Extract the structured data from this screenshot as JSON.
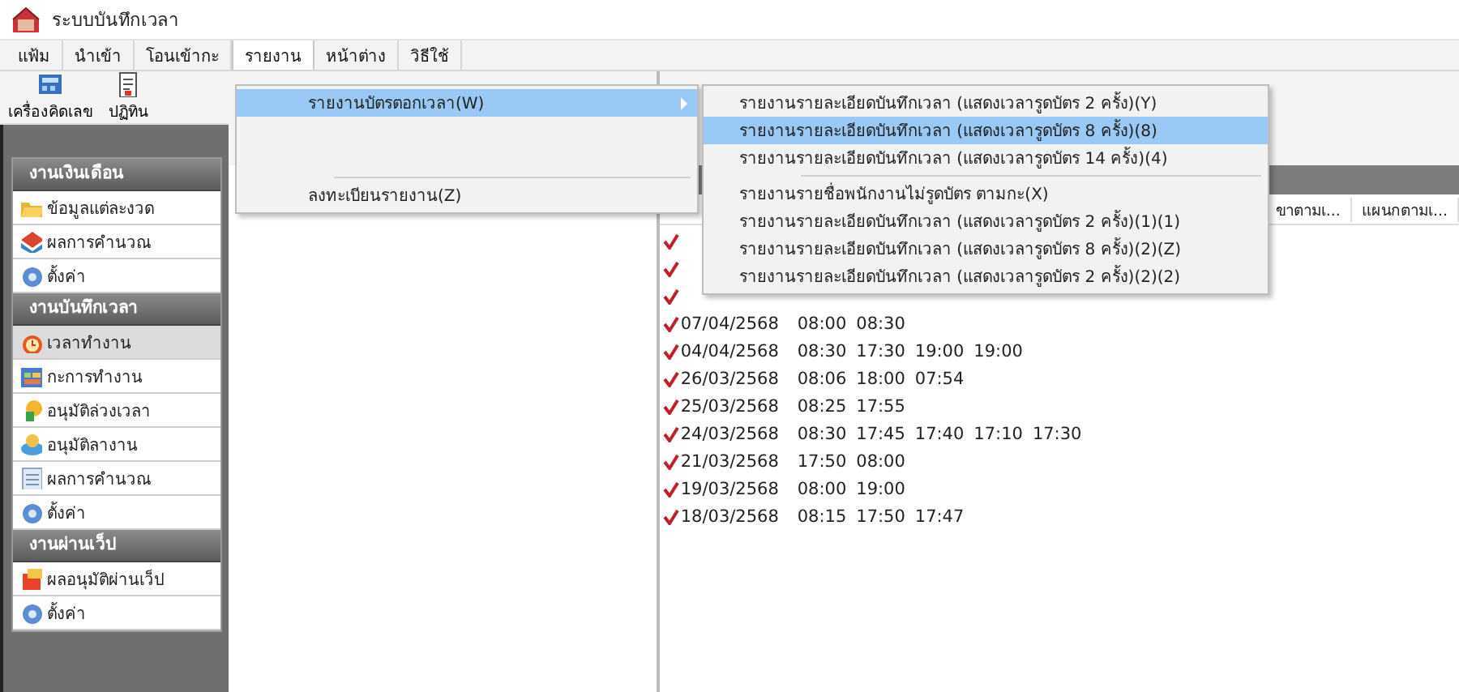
{
  "window": {
    "title": "ระบบบันทึกเวลา"
  },
  "menu_bar": [
    {
      "label": "แฟ้ม",
      "selected": false
    },
    {
      "label": "นำเข้า",
      "selected": false
    },
    {
      "label": "โอนเข้ากะ",
      "selected": false
    },
    {
      "label": "รายงาน",
      "selected": true
    },
    {
      "label": "หน้าต่าง",
      "selected": false
    },
    {
      "label": "วิธีใช้",
      "selected": false
    }
  ],
  "toolbar": [
    {
      "label": "เครื่องคิดเลข",
      "kind": "calculator"
    },
    {
      "label": "ปฏิทิน",
      "kind": "calendar"
    }
  ],
  "sidebar": {
    "groups": [
      {
        "title": "งานเงินเดือน",
        "items": [
          {
            "label": "ข้อมูลแต่ละงวด",
            "kind": "folder",
            "selected": false
          },
          {
            "label": "ผลการคำนวณ",
            "kind": "result",
            "selected": false
          },
          {
            "label": "ตั้งค่า",
            "kind": "gear",
            "selected": false
          }
        ]
      },
      {
        "title": "งานบันทึกเวลา",
        "items": [
          {
            "label": "เวลาทำงาน",
            "kind": "clock",
            "selected": true
          },
          {
            "label": "กะการทำงาน",
            "kind": "schedule",
            "selected": false
          },
          {
            "label": "อนุมัติล่วงเวลา",
            "kind": "approve",
            "selected": false
          },
          {
            "label": "อนุมัติลางาน",
            "kind": "leave",
            "selected": false
          },
          {
            "label": "ผลการคำนวณ",
            "kind": "list",
            "selected": false
          },
          {
            "label": "ตั้งค่า",
            "kind": "gear",
            "selected": false
          }
        ]
      },
      {
        "title": "งานผ่านเว็ป",
        "items": [
          {
            "label": "ผลอนุมัติผ่านเว็ป",
            "kind": "web",
            "selected": false
          },
          {
            "label": "ตั้งค่า",
            "kind": "gear",
            "selected": false
          }
        ]
      }
    ]
  },
  "report_menu": {
    "items": [
      {
        "label": "รายงานบัตรตอกเวลา(W)",
        "selected": true,
        "has_submenu": true,
        "separator_before": false
      },
      {
        "label": "ลงทะเบียนรายงาน(Z)",
        "selected": false,
        "has_submenu": false,
        "separator_before": true
      }
    ]
  },
  "submenu": {
    "items": [
      {
        "label": "รายงานรายละเอียดบันทึกเวลา (แสดงเวลารูดบัตร 2 ครั้ง)(Y)",
        "selected": false,
        "separator_before": false
      },
      {
        "label": "รายงานรายละเอียดบันทึกเวลา (แสดงเวลารูดบัตร 8 ครั้ง)(8)",
        "selected": true,
        "separator_before": false
      },
      {
        "label": "รายงานรายละเอียดบันทึกเวลา (แสดงเวลารูดบัตร 14 ครั้ง)(4)",
        "selected": false,
        "separator_before": false
      },
      {
        "label": "รายงานรายชื่อพนักงานไม่รูดบัตร ตามกะ(X)",
        "selected": false,
        "separator_before": true
      },
      {
        "label": "รายงานรายละเอียดบันทึกเวลา (แสดงเวลารูดบัตร 2 ครั้ง)(1)(1)",
        "selected": false,
        "separator_before": false
      },
      {
        "label": "รายงานรายละเอียดบันทึกเวลา (แสดงเวลารูดบัตร 8 ครั้ง)(2)(Z)",
        "selected": false,
        "separator_before": false
      },
      {
        "label": "รายงานรายละเอียดบันทึกเวลา (แสดงเวลารูดบัตร 2 ครั้ง)(2)(2)",
        "selected": false,
        "separator_before": false
      }
    ]
  },
  "records": {
    "columns": [
      "ขาตามเ...",
      "แผนกตามเ..."
    ],
    "rows": [
      {
        "checked": true
      },
      {
        "checked": true
      },
      {
        "checked": true
      },
      {
        "checked": true,
        "date": "07/04/2568",
        "times": [
          "08:00",
          "08:30"
        ]
      },
      {
        "checked": true,
        "date": "04/04/2568",
        "times": [
          "08:30",
          "17:30",
          "19:00",
          "19:00"
        ]
      },
      {
        "checked": true,
        "date": "26/03/2568",
        "times": [
          "08:06",
          "18:00",
          "07:54"
        ]
      },
      {
        "checked": true,
        "date": "25/03/2568",
        "times": [
          "08:25",
          "17:55"
        ]
      },
      {
        "checked": true,
        "date": "24/03/2568",
        "times": [
          "08:30",
          "17:45",
          "17:40",
          "17:10",
          "17:30"
        ]
      },
      {
        "checked": true,
        "date": "21/03/2568",
        "times": [
          "17:50",
          "08:00"
        ]
      },
      {
        "checked": true,
        "date": "19/03/2568",
        "times": [
          "08:00",
          "19:00"
        ]
      },
      {
        "checked": true,
        "date": "18/03/2568",
        "times": [
          "08:15",
          "17:50",
          "17:47"
        ]
      }
    ]
  }
}
